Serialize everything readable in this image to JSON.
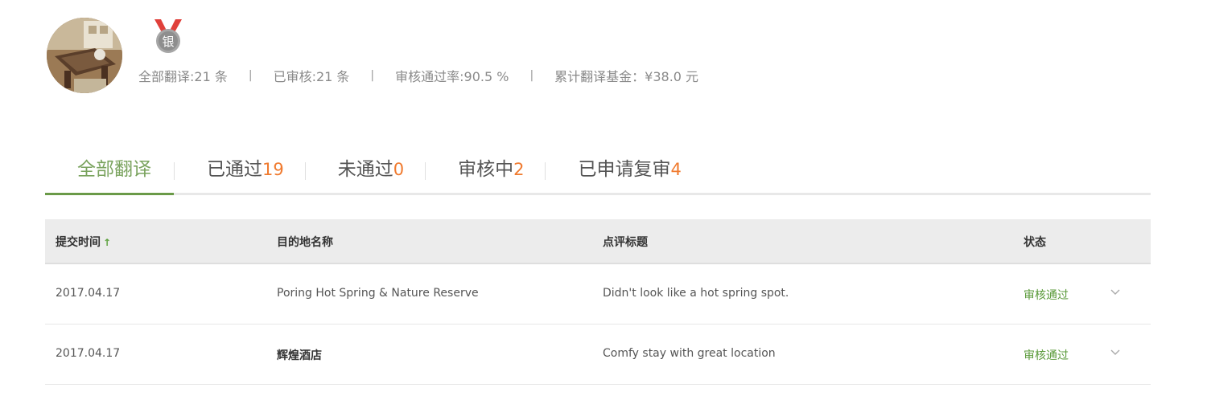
{
  "profile": {
    "badge_text": "银",
    "stats": {
      "total": "全部翻译:21 条",
      "reviewed": "已审核:21 条",
      "pass_rate": "审核通过率:90.5 %",
      "fund": "累计翻译基金：¥38.0 元"
    },
    "separator": "|"
  },
  "tabs": [
    {
      "label": "全部翻译",
      "count": ""
    },
    {
      "label": "已通过",
      "count": "19"
    },
    {
      "label": "未通过",
      "count": "0"
    },
    {
      "label": "审核中",
      "count": "2"
    },
    {
      "label": "已申请复审",
      "count": "4"
    }
  ],
  "table": {
    "columns": {
      "submit_time": "提交时间",
      "sort_icon": "↑",
      "destination": "目的地名称",
      "review_title": "点评标题",
      "status": "状态"
    },
    "rows": [
      {
        "date": "2017.04.17",
        "destination": "Poring Hot Spring & Nature Reserve",
        "title": "Didn't look like a hot spring spot.",
        "status": "审核通过"
      },
      {
        "date": "2017.04.17",
        "destination": "辉煌酒店",
        "title": "Comfy stay with great location",
        "status": "审核通过"
      }
    ]
  },
  "colors": {
    "accent_green": "#6a9a48",
    "count_orange": "#f07a2e",
    "status_green": "#5a9a3a",
    "medal_ribbon": "#e0403a",
    "medal_silver": "#9a9a9a"
  },
  "icons": {
    "medal": "silver-medal-icon",
    "sort": "sort-up-arrow-icon",
    "expand": "chevron-down-icon"
  }
}
